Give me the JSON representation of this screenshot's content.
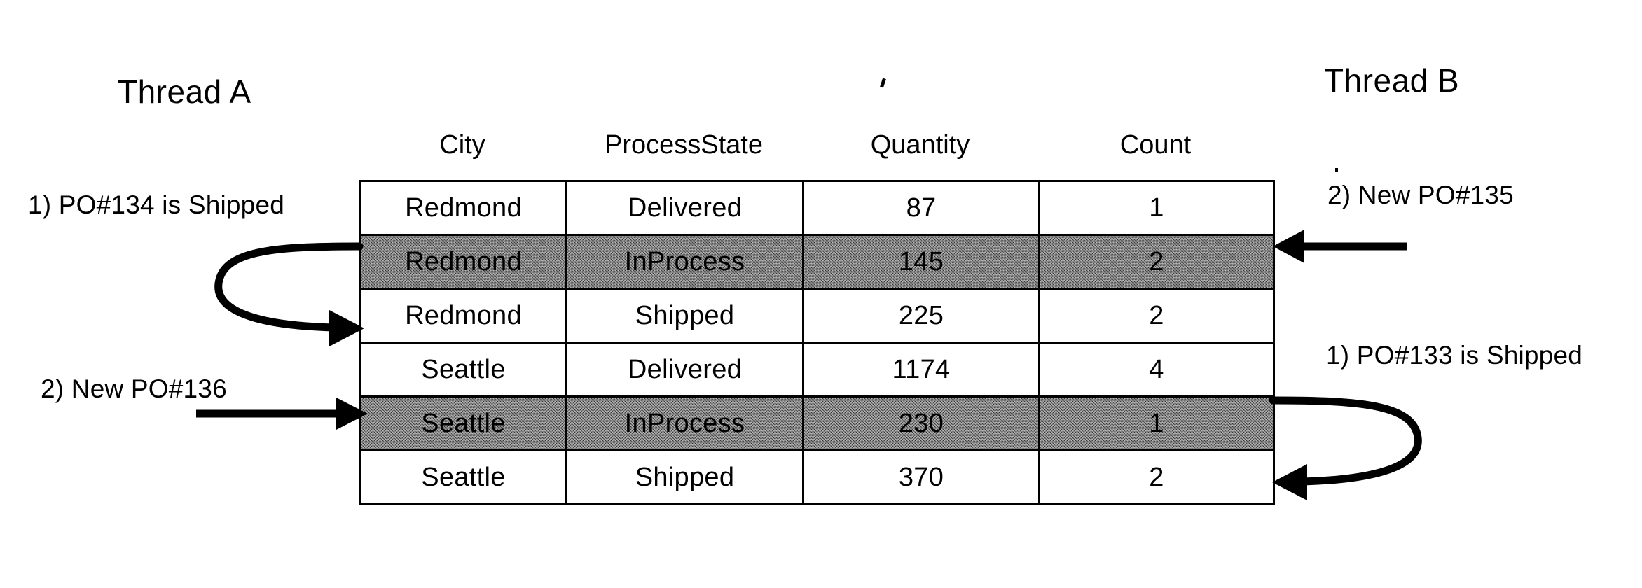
{
  "diagram": {
    "threads": {
      "left_label": "Thread A",
      "right_label": "Thread B"
    },
    "annotations": {
      "left_top": "1) PO#134 is Shipped",
      "left_bottom": "2) New PO#136",
      "right_top": "2) New PO#135",
      "right_bottom": "1) PO#133 is Shipped"
    }
  },
  "table": {
    "headers": {
      "city": "City",
      "process_state": "ProcessState",
      "quantity": "Quantity",
      "count": "Count"
    },
    "columns": [
      "City",
      "ProcessState",
      "Quantity",
      "Count"
    ],
    "rows": [
      {
        "city": "Redmond",
        "process_state": "Delivered",
        "quantity": "87",
        "count": "1",
        "highlighted": false
      },
      {
        "city": "Redmond",
        "process_state": "InProcess",
        "quantity": "145",
        "count": "2",
        "highlighted": true
      },
      {
        "city": "Redmond",
        "process_state": "Shipped",
        "quantity": "225",
        "count": "2",
        "highlighted": false
      },
      {
        "city": "Seattle",
        "process_state": "Delivered",
        "quantity": "1174",
        "count": "4",
        "highlighted": false
      },
      {
        "city": "Seattle",
        "process_state": "InProcess",
        "quantity": "230",
        "count": "1",
        "highlighted": true
      },
      {
        "city": "Seattle",
        "process_state": "Shipped",
        "quantity": "370",
        "count": "2",
        "highlighted": false
      }
    ]
  },
  "colors": {
    "ink": "#000000",
    "paper": "#ffffff",
    "highlight_fill": "#b8b8b8"
  }
}
